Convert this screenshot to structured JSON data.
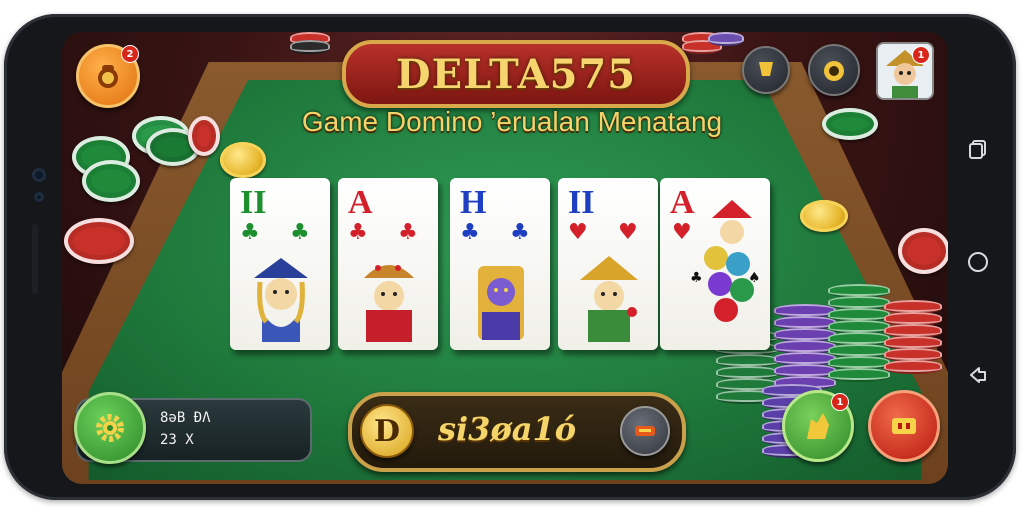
{
  "header": {
    "title": "DELTA575",
    "subtitle": "Game Domino ’erualan Menatang"
  },
  "top_left": {
    "badge": "2"
  },
  "top_right": {
    "avatar_badge": "1"
  },
  "cards": [
    {
      "rank": "II",
      "rank_color": "#1d8f2f",
      "suit": "♣",
      "suit_color": "#1d8f2f"
    },
    {
      "rank": "A",
      "rank_color": "#d4202a",
      "suit": "♣",
      "suit_color": "#d4202a"
    },
    {
      "rank": "H",
      "rank_color": "#1f3fc2",
      "suit": "♣",
      "suit_color": "#1f3fc2"
    },
    {
      "rank": "II",
      "rank_color": "#1f3fc2",
      "suit": "♥",
      "suit_color": "#d4202a"
    },
    {
      "rank": "A",
      "rank_color": "#d4202a",
      "suit": "♥",
      "suit_color": "#d4202a"
    }
  ],
  "info_panel": {
    "line1": "8ǝB ĐΛ",
    "line2": "23 Х"
  },
  "center_panel": {
    "icon_letter": "D",
    "label": "si3øa1ó"
  },
  "right_button_badge": "1",
  "colors": {
    "felt": "#1f7a3c",
    "title_gold": "#f7d56e",
    "panel_border": "#caa04a",
    "button_green": "#3aa13a",
    "button_red": "#d0271d",
    "button_orange": "#ef8a1a"
  },
  "icons": {
    "top_left": "coin-bag-icon",
    "top_right_1": "trophy-icon",
    "top_right_2": "gift-icon",
    "avatar": "player-avatar",
    "settings": "gear-icon",
    "shop": "cart-icon",
    "bonus": "hand-icon",
    "exit": "box-icon",
    "nav_recent": "recent-apps-icon",
    "nav_home": "home-icon",
    "nav_back": "back-icon"
  }
}
